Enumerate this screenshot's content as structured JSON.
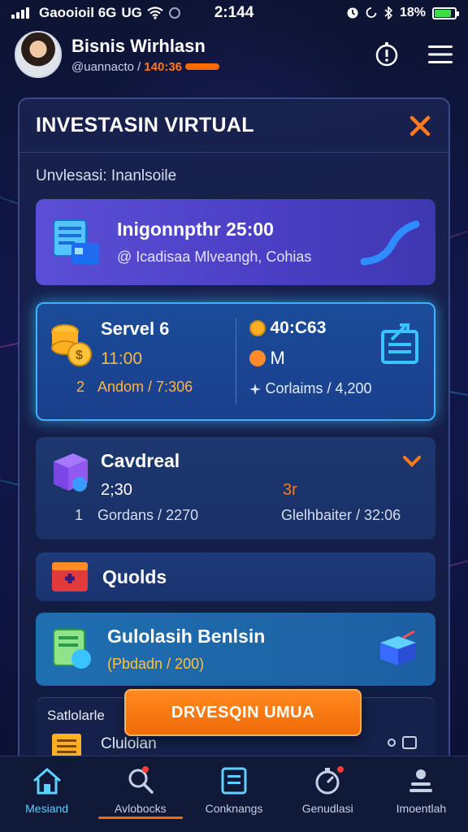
{
  "status_bar": {
    "carrier": "Gaooioil 6G",
    "network": "UG",
    "time": "2:144",
    "battery": "18%",
    "battery_level": 0.85
  },
  "header": {
    "name": "Bisnis Wirhlasn",
    "handle": "@uannacto /",
    "handle_accent": "140:36"
  },
  "panel": {
    "title": "INVESTASIN VIRTUAL",
    "section_label": "Unvlesasi: Inanlsoile"
  },
  "cards": {
    "a": {
      "title": "Inigonnpthr 25:00",
      "subtitle": "@ Icadisaa Mlveangh, Cohias"
    },
    "b": {
      "left_title": "Servel 6",
      "left_value": "11:00",
      "left_foot_num": "2",
      "left_foot": "Andom / 7:306",
      "right_title": "40:C63",
      "right_value": "M",
      "right_foot": "Corlaims / 4,200"
    },
    "c": {
      "title": "Cavdreal",
      "value": "2;30",
      "value2": "3r",
      "foot_num": "1",
      "foot": "Gordans / 2270",
      "foot2": "Glelhbaiter / 32:06"
    },
    "d": {
      "title": "Quolds"
    },
    "e": {
      "title": "Gulolasih Benlsin",
      "subtitle": "(Pbdadn / 200)"
    },
    "f": {
      "label": "Satlolarle",
      "label2": "Clulolan"
    }
  },
  "cta": {
    "label": "DRVESQIN UMUA"
  },
  "nav": {
    "items": [
      {
        "label": "Mesiand"
      },
      {
        "label": "Avlobocks"
      },
      {
        "label": "Conknangs"
      },
      {
        "label": "Genudlasi"
      },
      {
        "label": "Imoentlah"
      }
    ]
  },
  "colors": {
    "accent_orange": "#ff6a00",
    "highlight_blue": "#3bb4ff",
    "card_purple": "#5a4fd6",
    "gold": "#ffb83b"
  }
}
